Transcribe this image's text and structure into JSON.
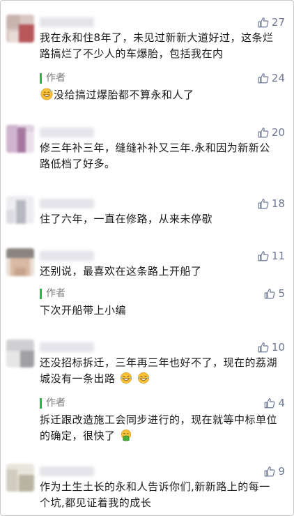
{
  "comments": [
    {
      "likes": "27",
      "text": "我在永和住8年了，未见过新新大道好过，这条烂路搞烂了不少人的车爆胎，包括我在内",
      "reply": {
        "author": "作者",
        "likes": "24",
        "emoji": "grin-sweat",
        "text": "没给搞过爆胎都不算永和人了"
      }
    },
    {
      "likes": "20",
      "text": "修三年补三年，缝缝补补又三年.永和因为新新公路低档了好多。"
    },
    {
      "likes": "18",
      "text": "住了六年，一直在修路，从来未停歇"
    },
    {
      "likes": "11",
      "text": "还别说，最喜欢在这条路上开船了",
      "reply": {
        "author": "作者",
        "likes": "5",
        "text": "下次开船带上小编"
      }
    },
    {
      "likes": "10",
      "text": "还没招标拆迁，三年再三年也好不了，现在的荔湖城没有一条出路",
      "trailing_emoji": "tears-of-joy",
      "reply": {
        "author": "作者",
        "likes": "4",
        "text": "拆迁跟改造施工会同步进行的，现在就等中标单位的确定，很快了",
        "trailing_emoji": "vomit"
      }
    },
    {
      "likes": "9",
      "text": "作为土生土长的永和人告诉你们,新新路上的每一个坑,都见证着我的成长"
    }
  ],
  "colors": {
    "like": "#6b7693",
    "author_bar": "#2bb24c",
    "author_text": "#7c7c7c",
    "body_text": "#1a1a1a"
  }
}
